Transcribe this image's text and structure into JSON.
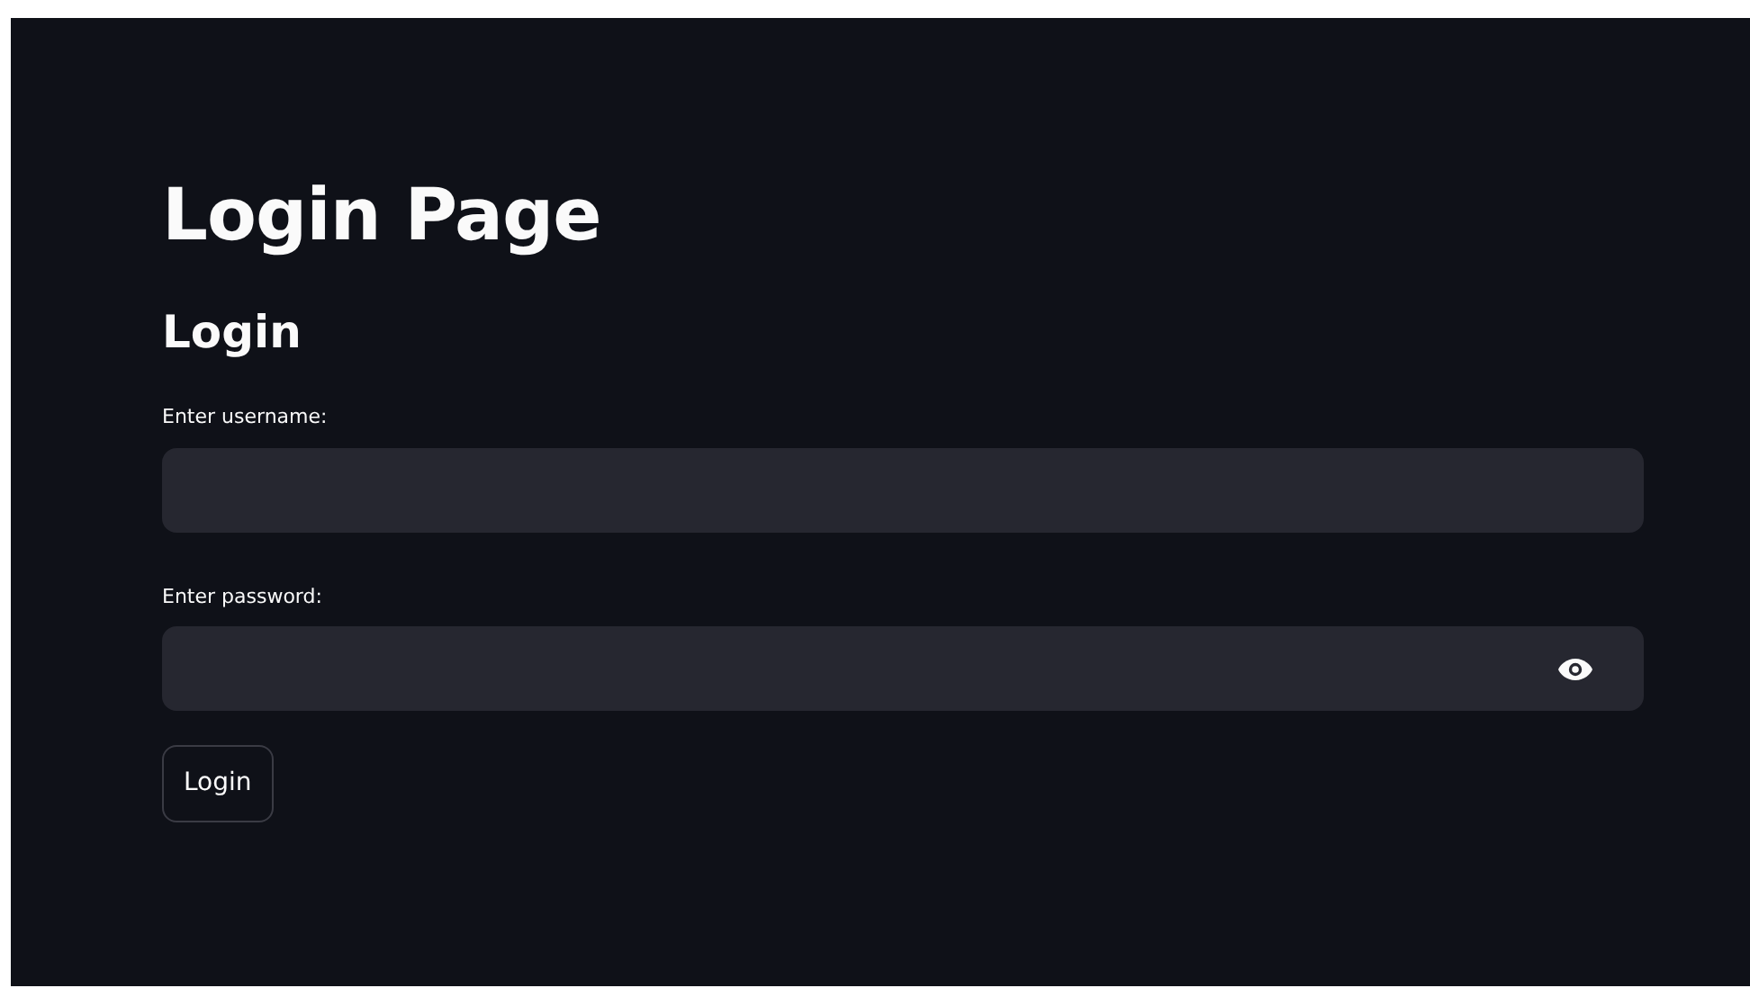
{
  "title": "Login Page",
  "form": {
    "heading": "Login",
    "fields": [
      {
        "label": "Enter username:",
        "kind": "text"
      },
      {
        "label": "Enter password:",
        "kind": "password"
      }
    ],
    "submit": "Login"
  }
}
